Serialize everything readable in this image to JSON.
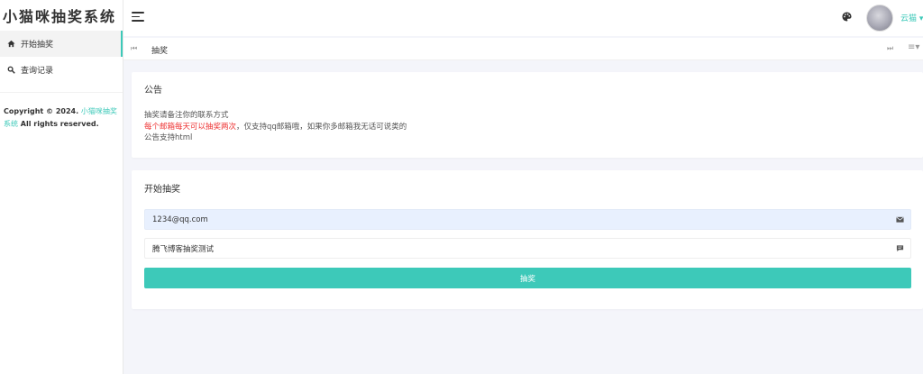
{
  "app": {
    "title": "小猫咪抽奖系统"
  },
  "sidebar": {
    "items": [
      {
        "label": "开始抽奖",
        "icon": "home-icon",
        "active": true
      },
      {
        "label": "查询记录",
        "icon": "search-icon",
        "active": false
      }
    ],
    "copyright_prefix": "Copyright © 2024.",
    "copyright_link": "小猫咪抽奖系统",
    "copyright_suffix": "All rights reserved."
  },
  "topbar": {
    "menu_icon": "hamburger-icon",
    "theme_icon": "palette-icon",
    "user_name": "云猫 ▾"
  },
  "tabs": {
    "prev_icon": "⏮",
    "items": [
      {
        "label": "抽奖"
      }
    ],
    "next_icon": "⏭",
    "menu_icon": "≡▾"
  },
  "notice": {
    "title": "公告",
    "line1": "抽奖请备注你的联系方式",
    "line2_red": "每个邮箱每天可以抽奖两次",
    "line2_rest": "，仅支持qq邮箱哦，如果你多邮箱我无话可说类的",
    "line3": "公告支持html"
  },
  "draw": {
    "title": "开始抽奖",
    "email_value": "1234@qq.com",
    "message_value": "腾飞博客抽奖测试",
    "button_label": "抽奖"
  },
  "colors": {
    "accent": "#3dc9b9",
    "notice_red": "#ee3333",
    "autofill_bg": "#e8f0fe"
  }
}
